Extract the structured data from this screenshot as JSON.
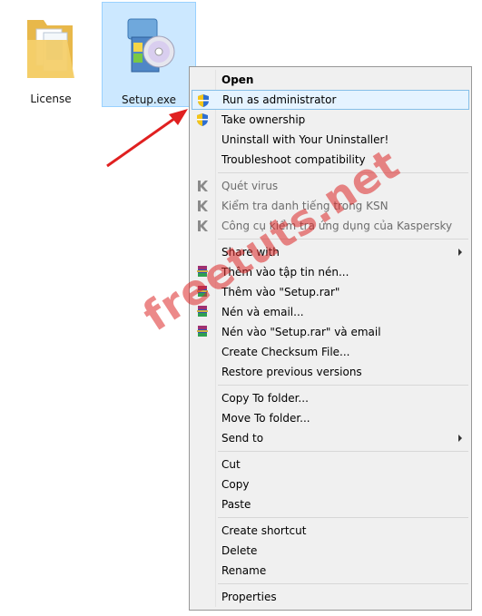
{
  "desktop": {
    "files": [
      {
        "name": "License"
      },
      {
        "name": "Setup.exe"
      }
    ]
  },
  "context_menu": {
    "items": {
      "open": "Open",
      "run_as_admin": "Run as administrator",
      "take_ownership": "Take ownership",
      "uninstall": "Uninstall with Your Uninstaller!",
      "troubleshoot": "Troubleshoot compatibility",
      "scan_virus": "Quét virus",
      "check_ksn": "Kiểm tra danh tiếng trong KSN",
      "kaspersky_tool": "Công cụ kiểm tra ứng dụng của Kaspersky",
      "share_with": "Share with",
      "add_archive": "Thêm vào tập tin nén...",
      "add_setup_rar": "Thêm vào \"Setup.rar\"",
      "compress_email": "Nén và email...",
      "compress_setup_email": "Nén vào \"Setup.rar\" và email",
      "create_checksum": "Create Checksum File...",
      "restore_versions": "Restore previous versions",
      "copy_to_folder": "Copy To folder...",
      "move_to_folder": "Move To folder...",
      "send_to": "Send to",
      "cut": "Cut",
      "copy": "Copy",
      "paste": "Paste",
      "create_shortcut": "Create shortcut",
      "delete": "Delete",
      "rename": "Rename",
      "properties": "Properties"
    }
  },
  "watermark": "freetuts.net",
  "colors": {
    "selection_bg": "#cce8ff",
    "highlight_bg": "#e5f3ff",
    "highlight_border": "#86bfe8",
    "menu_bg": "#f0f0f0",
    "arrow": "#e02020",
    "watermark": "#dc2828"
  }
}
